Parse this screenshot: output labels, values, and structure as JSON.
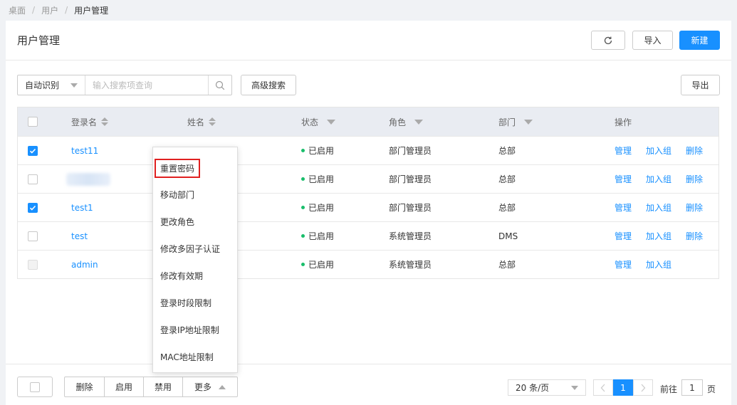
{
  "breadcrumb": {
    "items": [
      "桌面",
      "用户"
    ],
    "current": "用户管理"
  },
  "header": {
    "title": "用户管理",
    "import_label": "导入",
    "new_label": "新建"
  },
  "toolbar": {
    "search_mode": "自动识别",
    "search_placeholder": "输入搜索项查询",
    "advanced_search_label": "高级搜索",
    "export_label": "导出"
  },
  "table": {
    "columns": {
      "login": "登录名",
      "name": "姓名",
      "status": "状态",
      "role": "角色",
      "dept": "部门",
      "ops": "操作"
    },
    "rows": [
      {
        "login": "test11",
        "status": "已启用",
        "role": "部门管理员",
        "dept": "总部",
        "checked": true,
        "actions": [
          "管理",
          "加入组",
          "删除"
        ]
      },
      {
        "login": "",
        "status": "已启用",
        "role": "部门管理员",
        "dept": "总部",
        "checked": false,
        "actions": [
          "管理",
          "加入组",
          "删除"
        ]
      },
      {
        "login": "test1",
        "status": "已启用",
        "role": "部门管理员",
        "dept": "总部",
        "checked": true,
        "actions": [
          "管理",
          "加入组",
          "删除"
        ]
      },
      {
        "login": "test",
        "status": "已启用",
        "role": "系统管理员",
        "dept": "DMS",
        "checked": false,
        "actions": [
          "管理",
          "加入组",
          "删除"
        ]
      },
      {
        "login": "admin",
        "status": "已启用",
        "role": "系统管理员",
        "dept": "总部",
        "checked": false,
        "disabled": true,
        "actions": [
          "管理",
          "加入组"
        ]
      }
    ]
  },
  "more_menu": {
    "items": [
      "重置密码",
      "移动部门",
      "更改角色",
      "修改多因子认证",
      "修改有效期",
      "登录时段限制",
      "登录IP地址限制",
      "MAC地址限制"
    ],
    "highlighted": "重置密码"
  },
  "footer": {
    "bulk_actions": [
      "删除",
      "启用",
      "禁用",
      "更多"
    ],
    "page_size": "20 条/页",
    "current_page": "1",
    "goto_label": "前往",
    "goto_value": "1",
    "page_unit": "页"
  },
  "colors": {
    "primary": "#1890ff",
    "status_enabled": "#19be6b",
    "highlight_border": "#e02020"
  }
}
